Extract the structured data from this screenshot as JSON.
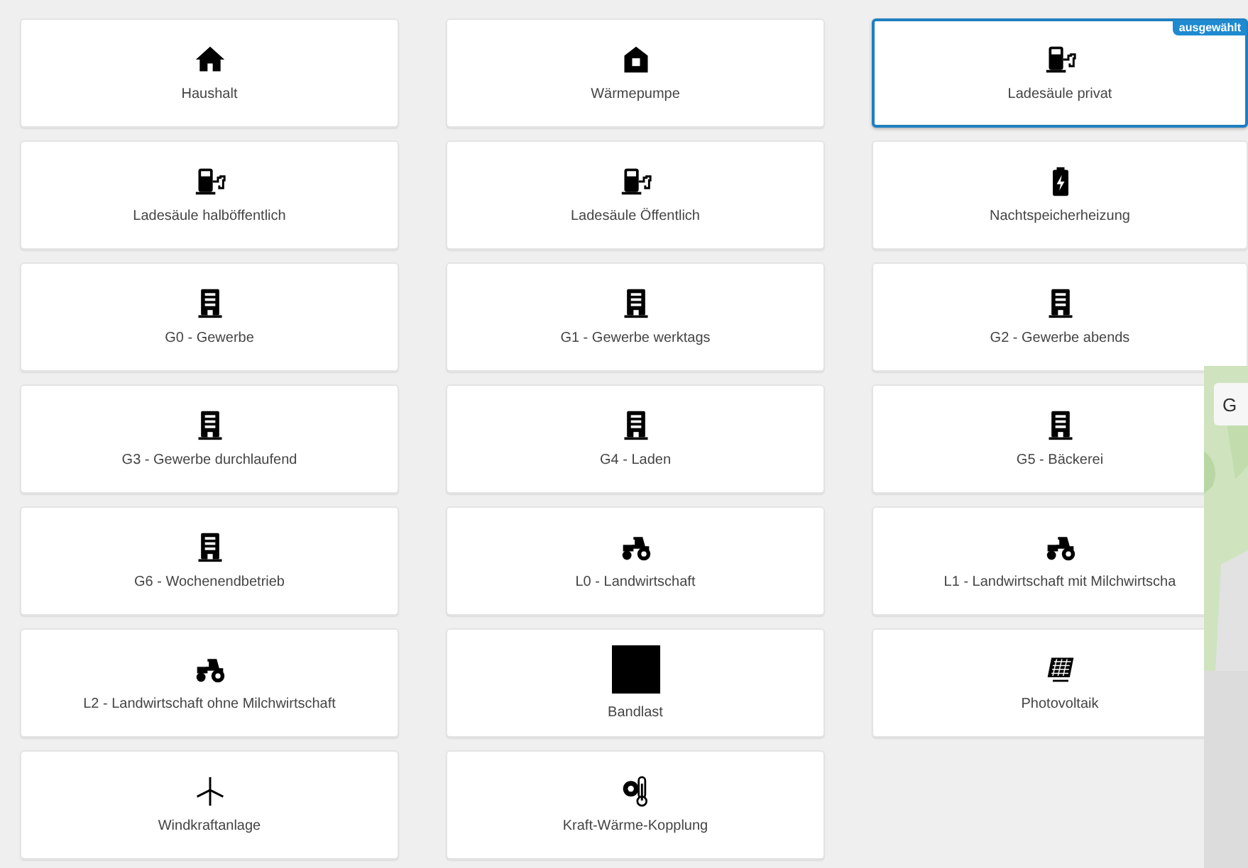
{
  "cards": [
    {
      "label": "Haushalt",
      "kind": "house",
      "selected": false
    },
    {
      "label": "Wärmepumpe",
      "kind": "heatpump",
      "selected": false
    },
    {
      "label": "Ladesäule privat",
      "kind": "charger",
      "selected": true
    },
    {
      "label": "Ladesäule halböffentlich",
      "kind": "charger",
      "selected": false
    },
    {
      "label": "Ladesäule Öffentlich",
      "kind": "charger",
      "selected": false
    },
    {
      "label": "Nachtspeicherheizung",
      "kind": "battery",
      "selected": false
    },
    {
      "label": "G0 - Gewerbe",
      "kind": "building",
      "selected": false
    },
    {
      "label": "G1 - Gewerbe werktags",
      "kind": "building",
      "selected": false
    },
    {
      "label": "G2 - Gewerbe abends",
      "kind": "building",
      "selected": false
    },
    {
      "label": "G3 - Gewerbe durchlaufend",
      "kind": "building",
      "selected": false
    },
    {
      "label": "G4 - Laden",
      "kind": "building",
      "selected": false
    },
    {
      "label": "G5 - Bäckerei",
      "kind": "building",
      "selected": false
    },
    {
      "label": "G6 - Wochenendbetrieb",
      "kind": "building",
      "selected": false
    },
    {
      "label": "L0 - Landwirtschaft",
      "kind": "tractor",
      "selected": false
    },
    {
      "label": "L1 - Landwirtschaft mit Milchwirtscha",
      "kind": "tractor",
      "selected": false
    },
    {
      "label": "L2 - Landwirtschaft ohne Milchwirtschaft",
      "kind": "tractor",
      "selected": false
    },
    {
      "label": "Bandlast",
      "kind": "square",
      "selected": false
    },
    {
      "label": "Photovoltaik",
      "kind": "solar",
      "selected": false
    },
    {
      "label": "Windkraftanlage",
      "kind": "wind",
      "selected": false
    },
    {
      "label": "Kraft-Wärme-Kopplung",
      "kind": "chp",
      "selected": false
    }
  ],
  "selected_badge": "ausgewählt",
  "map_panel": {
    "button": "G"
  }
}
